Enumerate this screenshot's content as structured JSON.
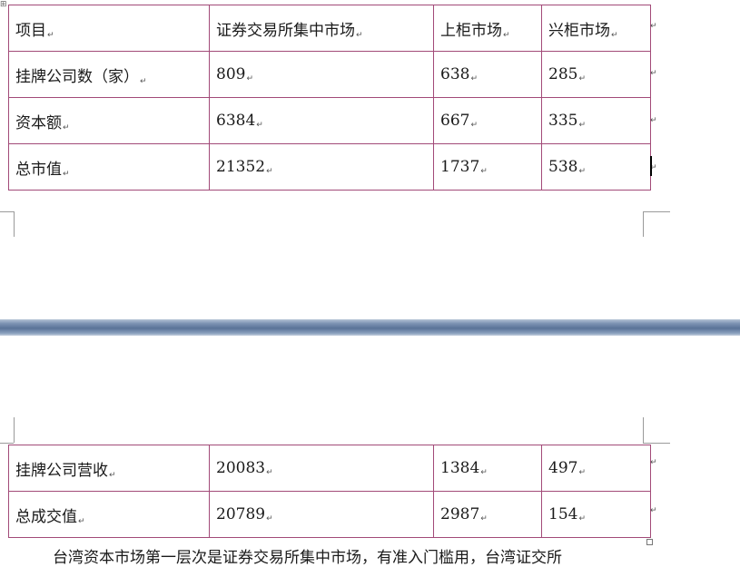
{
  "return_mark": "↵",
  "table_top": {
    "rows": [
      [
        "项目",
        "证券交易所集中市场",
        "上柜市场",
        "兴柜市场"
      ],
      [
        "挂牌公司数（家）",
        "809",
        "638",
        "285"
      ],
      [
        "资本额",
        "6384",
        "667",
        "335"
      ],
      [
        "总市值",
        "21352",
        "1737",
        "538"
      ]
    ]
  },
  "table_bottom": {
    "rows": [
      [
        "挂牌公司营收",
        "20083",
        "1384",
        "497"
      ],
      [
        "总成交值",
        "20789",
        "2987",
        "154"
      ]
    ]
  },
  "paragraph_partial": "台湾资本市场第一层次是证券交易所集中市场，有准入门槛用，台湾证交所"
}
